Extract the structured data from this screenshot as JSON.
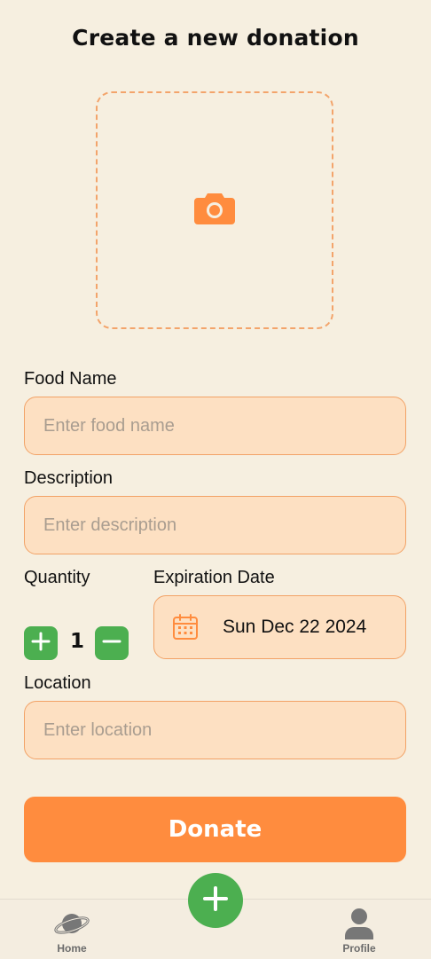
{
  "header": {
    "title": "Create a new donation"
  },
  "photo": {
    "icon": "camera-icon",
    "color": "#ff8c3e"
  },
  "form": {
    "food_name": {
      "label": "Food Name",
      "placeholder": "Enter food name",
      "value": ""
    },
    "description": {
      "label": "Description",
      "placeholder": "Enter description",
      "value": ""
    },
    "quantity": {
      "label": "Quantity",
      "value": "1",
      "increment_icon": "plus-icon",
      "decrement_icon": "minus-icon"
    },
    "expiration": {
      "label": "Expiration Date",
      "value": "Sun Dec 22 2024",
      "icon": "calendar-icon"
    },
    "location": {
      "label": "Location",
      "placeholder": "Enter location",
      "value": ""
    }
  },
  "actions": {
    "donate_label": "Donate"
  },
  "nav": {
    "items": [
      {
        "label": "Home",
        "icon": "planet-icon"
      },
      {
        "label": "Profile",
        "icon": "user-icon"
      }
    ],
    "fab_icon": "plus-icon"
  },
  "colors": {
    "accent": "#ff8c3e",
    "green": "#4caf50",
    "background": "#f6efe0",
    "field": "#fde0c2"
  }
}
